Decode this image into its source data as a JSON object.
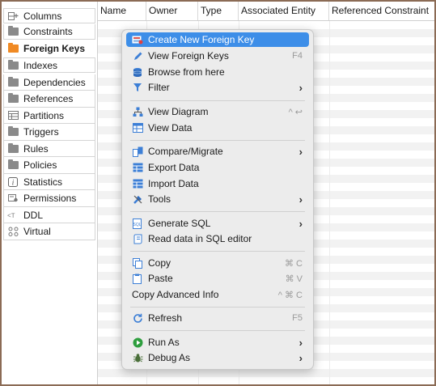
{
  "sidebar": {
    "items": [
      {
        "label": "Columns",
        "icon": "columns-icon"
      },
      {
        "label": "Constraints",
        "icon": "folder-icon"
      },
      {
        "label": "Foreign Keys",
        "icon": "folder-orange-icon",
        "active": true
      },
      {
        "label": "Indexes",
        "icon": "folder-icon"
      },
      {
        "label": "Dependencies",
        "icon": "folder-icon"
      },
      {
        "label": "References",
        "icon": "folder-icon"
      },
      {
        "label": "Partitions",
        "icon": "partitions-icon"
      },
      {
        "label": "Triggers",
        "icon": "folder-icon"
      },
      {
        "label": "Rules",
        "icon": "folder-icon"
      },
      {
        "label": "Policies",
        "icon": "folder-icon"
      },
      {
        "label": "Statistics",
        "icon": "info-icon"
      },
      {
        "label": "Permissions",
        "icon": "permissions-icon"
      },
      {
        "label": "DDL",
        "icon": "ddl-icon"
      },
      {
        "label": "Virtual",
        "icon": "virtual-icon"
      }
    ]
  },
  "table": {
    "columns": [
      "Name",
      "Owner",
      "Type",
      "Associated Entity",
      "Referenced Constraint"
    ]
  },
  "menu": {
    "items": [
      {
        "label": "Create New Foreign Key",
        "icon": "create-key-icon",
        "shortcut": "",
        "submenu": false,
        "highlight": true
      },
      {
        "label": "View Foreign Keys",
        "icon": "pencil-icon",
        "shortcut": "F4",
        "submenu": false
      },
      {
        "label": "Browse from here",
        "icon": "database-icon",
        "shortcut": "",
        "submenu": false
      },
      {
        "label": "Filter",
        "icon": "filter-icon",
        "shortcut": "",
        "submenu": true
      },
      {
        "label": "View Diagram",
        "icon": "diagram-icon",
        "shortcut": "^ ↩",
        "submenu": false
      },
      {
        "label": "View Data",
        "icon": "table-icon",
        "shortcut": "",
        "submenu": false
      },
      {
        "label": "Compare/Migrate",
        "icon": "compare-icon",
        "shortcut": "",
        "submenu": true
      },
      {
        "label": "Export Data",
        "icon": "export-icon",
        "shortcut": "",
        "submenu": false
      },
      {
        "label": "Import Data",
        "icon": "import-icon",
        "shortcut": "",
        "submenu": false
      },
      {
        "label": "Tools",
        "icon": "tools-icon",
        "shortcut": "",
        "submenu": true
      },
      {
        "label": "Generate SQL",
        "icon": "sql-icon",
        "shortcut": "",
        "submenu": true
      },
      {
        "label": "Read data in SQL editor",
        "icon": "scroll-icon",
        "shortcut": "",
        "submenu": false
      },
      {
        "label": "Copy",
        "icon": "copy-icon",
        "shortcut": "⌘ C",
        "submenu": false
      },
      {
        "label": "Paste",
        "icon": "paste-icon",
        "shortcut": "⌘ V",
        "submenu": false
      },
      {
        "label": "Copy Advanced Info",
        "icon": "",
        "shortcut": "^ ⌘ C",
        "submenu": false
      },
      {
        "label": "Refresh",
        "icon": "refresh-icon",
        "shortcut": "F5",
        "submenu": false
      },
      {
        "label": "Run As",
        "icon": "run-icon",
        "shortcut": "",
        "submenu": true
      },
      {
        "label": "Debug As",
        "icon": "debug-icon",
        "shortcut": "",
        "submenu": true
      }
    ]
  },
  "colors": {
    "highlight": "#3d8ee8",
    "folder": "#8a8a8a",
    "active_folder": "#f08a24",
    "frame_border": "#8b6b55"
  }
}
